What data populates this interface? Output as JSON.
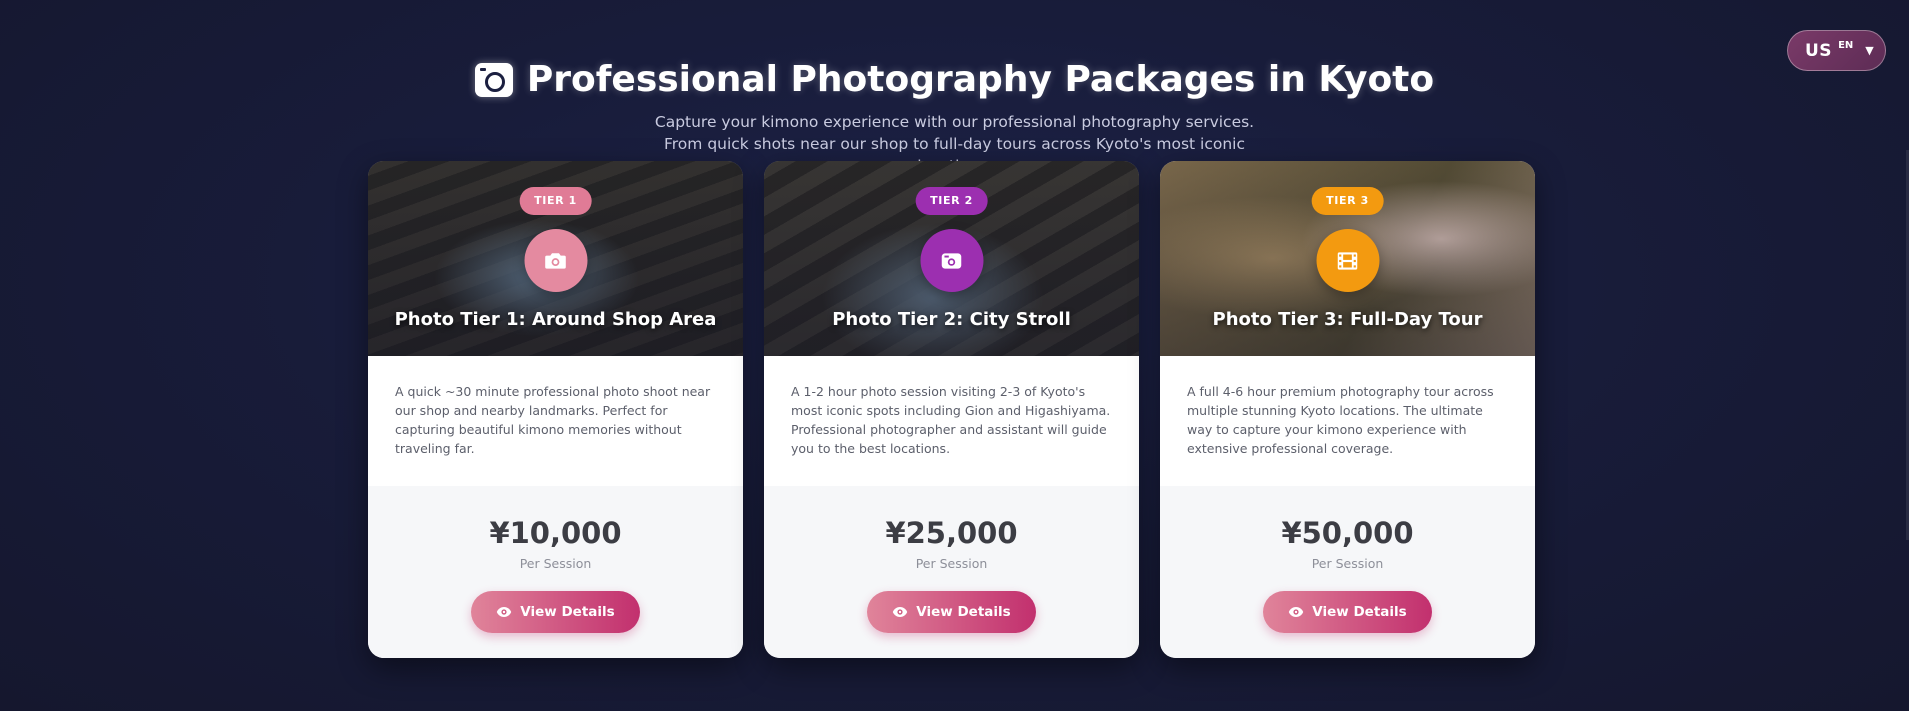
{
  "language": {
    "flag": "US",
    "code": "EN",
    "caret": "▼"
  },
  "header": {
    "title": "Professional Photography Packages in Kyoto",
    "subtitle": "Capture your kimono experience with our professional photography services. From quick shots near our shop to full-day tours across Kyoto's most iconic locations."
  },
  "cards": [
    {
      "badge": "TIER 1",
      "badge_color": "#e07b96",
      "icon": "camera-icon",
      "icon_color": "#e48aa0",
      "title": "Photo Tier 1: Around Shop Area",
      "description": "A quick ~30 minute professional photo shoot near our shop and nearby landmarks. Perfect for capturing beautiful kimono memories without traveling far.",
      "price": "¥10,000",
      "price_note": "Per Session",
      "button": "View Details"
    },
    {
      "badge": "TIER 2",
      "badge_color": "#9c2fb0",
      "icon": "camera-retro-icon",
      "icon_color": "#9c2fb0",
      "title": "Photo Tier 2: City Stroll",
      "description": "A 1-2 hour photo session visiting 2-3 of Kyoto's most iconic spots including Gion and Higashiyama. Professional photographer and assistant will guide you to the best locations.",
      "price": "¥25,000",
      "price_note": "Per Session",
      "button": "View Details"
    },
    {
      "badge": "TIER 3",
      "badge_color": "#f39a10",
      "icon": "film-icon",
      "icon_color": "#f39a10",
      "title": "Photo Tier 3: Full-Day Tour",
      "description": "A full 4-6 hour premium photography tour across multiple stunning Kyoto locations. The ultimate way to capture your kimono experience with extensive professional coverage.",
      "price": "¥50,000",
      "price_note": "Per Session",
      "button": "View Details"
    }
  ],
  "colors": {
    "background": "#1b1f40",
    "button_gradient_start": "#e0849a",
    "button_gradient_end": "#c2306e"
  }
}
